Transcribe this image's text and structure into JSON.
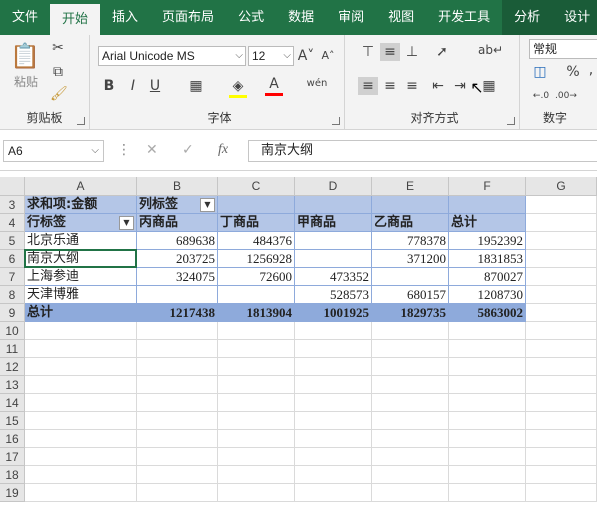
{
  "ribbon_tabs": [
    "文件",
    "开始",
    "插入",
    "页面布局",
    "公式",
    "数据",
    "审阅",
    "视图",
    "开发工具",
    "分析",
    "设计"
  ],
  "clipboard": {
    "paste": "粘贴",
    "group": "剪贴板"
  },
  "font": {
    "name": "Arial Unicode MS",
    "size": "12",
    "group": "字体",
    "bold": "B",
    "italic": "I",
    "underline": "U",
    "wen": "wén"
  },
  "alignment": {
    "group": "对齐方式"
  },
  "number": {
    "format": "常规",
    "group": "数字",
    "percent": "%",
    "comma": ","
  },
  "formula_bar": {
    "name_box": "A6",
    "fx": "fx",
    "content": "南京大纲"
  },
  "columns": [
    "A",
    "B",
    "C",
    "D",
    "E",
    "F",
    "G"
  ],
  "rows": [
    "3",
    "4",
    "5",
    "6",
    "7",
    "8",
    "9",
    "10",
    "11",
    "12",
    "13",
    "14",
    "15",
    "16",
    "17",
    "18",
    "19"
  ],
  "pivot": {
    "value_label": "求和项:金额",
    "col_label": "列标签",
    "row_label": "行标签",
    "headers": [
      "丙商品",
      "丁商品",
      "甲商品",
      "乙商品",
      "总计"
    ],
    "data": [
      {
        "name": "北京乐通",
        "vals": [
          "689638",
          "484376",
          "",
          "778378",
          "1952392"
        ]
      },
      {
        "name": "南京大纲",
        "vals": [
          "203725",
          "1256928",
          "",
          "371200",
          "1831853"
        ]
      },
      {
        "name": "上海参迪",
        "vals": [
          "324075",
          "72600",
          "473352",
          "",
          "870027"
        ]
      },
      {
        "name": "天津博雅",
        "vals": [
          "",
          "",
          "528573",
          "680157",
          "1208730"
        ]
      }
    ],
    "total": {
      "name": "总计",
      "vals": [
        "1217438",
        "1813904",
        "1001925",
        "1829735",
        "5863002"
      ]
    }
  },
  "colors": {
    "accent": "#217346",
    "pivot_light": "#b4c6e7",
    "pivot_dark": "#8eaadb"
  }
}
